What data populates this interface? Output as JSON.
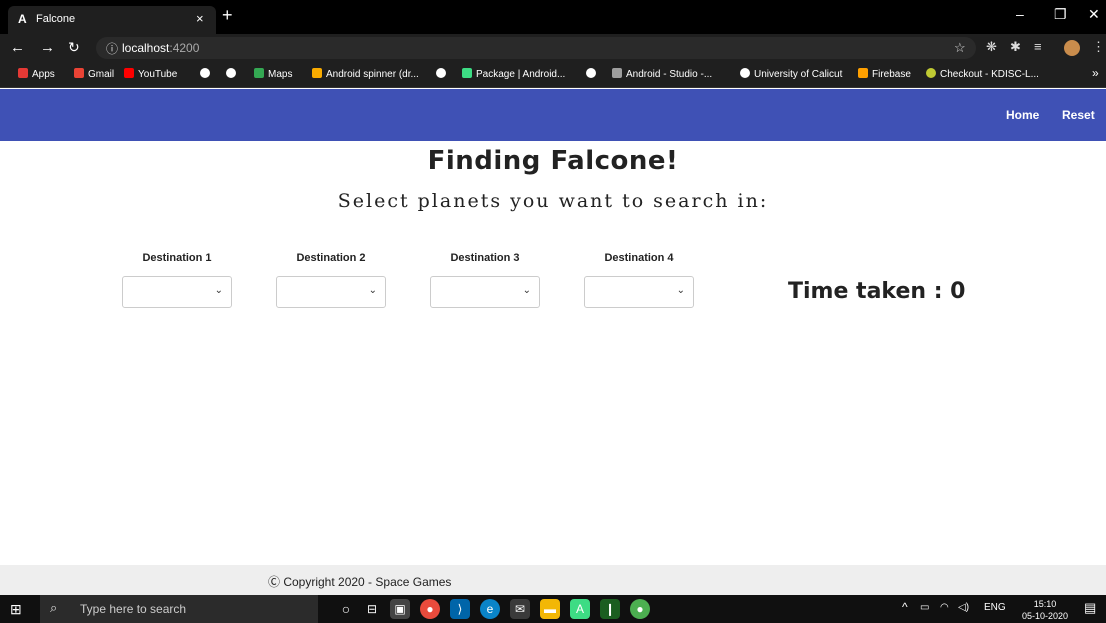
{
  "browser": {
    "tab_favicon": "A",
    "tab_title": "Falcone",
    "tab_close": "×",
    "new_tab": "+",
    "url_host": "localhost",
    "url_port": ":4200",
    "bookmarks": [
      {
        "label": "Apps",
        "color": "#e53935"
      },
      {
        "label": "Gmail",
        "color": "#ea4335"
      },
      {
        "label": "YouTube",
        "color": "#ff0000"
      },
      {
        "label": "",
        "color": "#ffffff"
      },
      {
        "label": "",
        "color": "#ffffff"
      },
      {
        "label": "Maps",
        "color": "#34a853"
      },
      {
        "label": "Android spinner (dr...",
        "color": "#f9ab00"
      },
      {
        "label": "",
        "color": "#ffffff"
      },
      {
        "label": "Package | Android...",
        "color": "#3ddc84"
      },
      {
        "label": "",
        "color": "#ffffff"
      },
      {
        "label": "Android - Studio -...",
        "color": "#9e9e9e"
      },
      {
        "label": "University of Calicut",
        "color": "#ffffff"
      },
      {
        "label": "Firebase",
        "color": "#ffa000"
      },
      {
        "label": "Checkout - KDISC-L...",
        "color": "#c0ca33"
      }
    ],
    "bookmarks_more": "»"
  },
  "navbar": {
    "home_label": "Home",
    "reset_label": "Reset",
    "color": "#3f51b5"
  },
  "main": {
    "title": "Finding Falcone!",
    "subtitle": "Select planets you want to search in:",
    "destinations": [
      {
        "label": "Destination 1",
        "value": ""
      },
      {
        "label": "Destination 2",
        "value": ""
      },
      {
        "label": "Destination 3",
        "value": ""
      },
      {
        "label": "Destination 4",
        "value": ""
      }
    ],
    "time_taken_label": "Time taken : 0"
  },
  "footer": {
    "copyright": "Ⓒ Copyright 2020 - Space Games"
  },
  "taskbar": {
    "search_placeholder": "Type here to search",
    "language": "ENG",
    "time": "15:10",
    "date": "05-10-2020"
  }
}
